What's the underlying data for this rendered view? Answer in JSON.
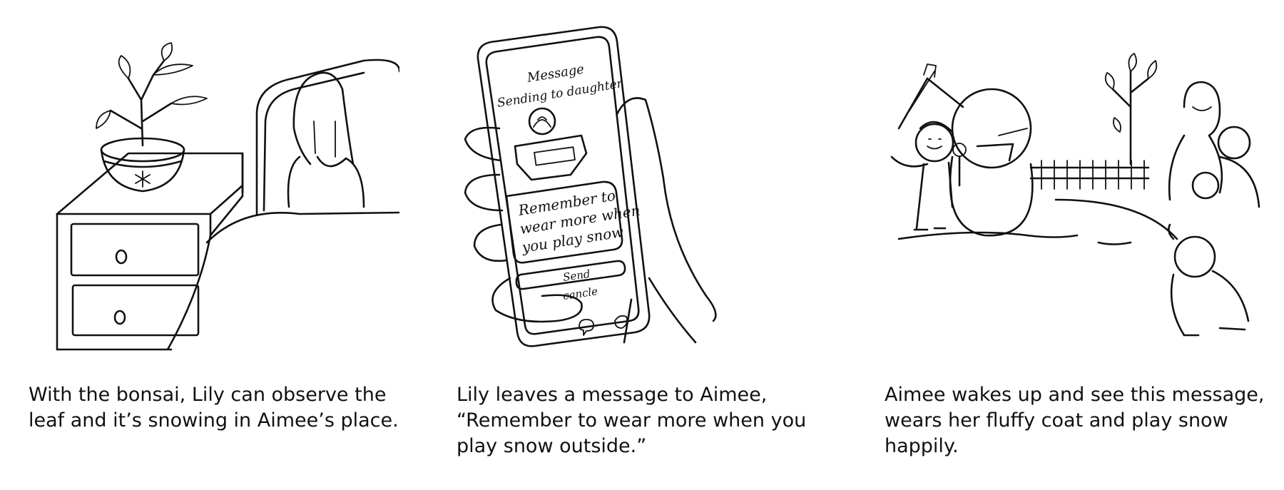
{
  "panels": [
    {
      "caption_lines": [
        "With the bonsai, Lily can observe the",
        "leaf and it’s snowing in Aimee’s place."
      ]
    },
    {
      "caption_lines": [
        "Lily leaves a message to Aimee,",
        "“Remember to wear more when you",
        "play snow outside.”"
      ],
      "phone": {
        "header_line1": "Message",
        "header_line2": "Sending to daughter",
        "message_lines": [
          "Remember to",
          "wear more when",
          "you play snow"
        ],
        "send_label": "Send",
        "cancel_label": "cancle"
      }
    },
    {
      "caption_lines": [
        "Aimee wakes up and see this message,",
        "wears her fluffy coat and play snow",
        "happily."
      ]
    }
  ]
}
